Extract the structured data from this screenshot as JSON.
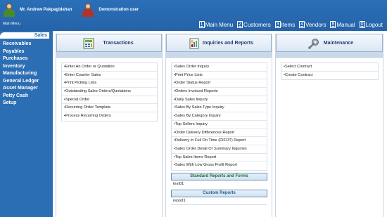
{
  "header": {
    "user_name": "Mr. Andrew Pakpagidahan",
    "company_name": "Demonstration user",
    "main_menu_label": "Main Menu"
  },
  "nav": [
    {
      "num": "1",
      "label": "Main Menu"
    },
    {
      "num": "2",
      "label": "Customers"
    },
    {
      "num": "3",
      "label": "Items"
    },
    {
      "num": "4",
      "label": "Vendors"
    },
    {
      "num": "8",
      "label": "Manual"
    },
    {
      "num": "0",
      "label": "Logout"
    }
  ],
  "sidebar": {
    "items": [
      {
        "label": "Sales"
      },
      {
        "label": "Receivables"
      },
      {
        "label": "Payables"
      },
      {
        "label": "Purchases"
      },
      {
        "label": "Inventory"
      },
      {
        "label": "Manufacturing"
      },
      {
        "label": "General Ledger"
      },
      {
        "label": "Asset Manager"
      },
      {
        "label": "Petty Cash"
      },
      {
        "label": "Setup"
      }
    ]
  },
  "columns": {
    "transactions": {
      "title": "Transactions",
      "icon": "transactions-icon",
      "items": [
        "Enter An Order or Quotation",
        "Enter Counter Sales",
        "Print Picking Lists",
        "Outstanding Sales Orders/Quotations",
        "Special Order",
        "Recurring Order Template",
        "Process Recurring Orders"
      ]
    },
    "inquiries": {
      "title": "Inquiries and Reports",
      "icon": "reports-icon",
      "items": [
        "Sales Order Inquiry",
        "Print Price Lists",
        "Order Status Report",
        "Orders Invoiced Reports",
        "Daily Sales Inquiry",
        "Sales By Sales Type Inquiry",
        "Sales By Category Inquiry",
        "Top Sellers Inquiry",
        "Order Delivery Differences Report",
        "Delivery In Full On Time (DIFOT) Report",
        "Sales Order Detail Or Summary Inquiries",
        "Top Sales Items Report",
        "Sales With Low Gross Profit Report"
      ],
      "standard_reports": {
        "title": "Standard Reports and Forms",
        "link": "test01"
      },
      "custom_reports": {
        "title": "Custom Reports",
        "link": "report1"
      }
    },
    "maintenance": {
      "title": "Maintenance",
      "icon": "wrench-gear-icon",
      "items": [
        "Select Contract",
        "Create Contract"
      ]
    }
  },
  "colors": {
    "background": "#2c6eb4",
    "panel": "#ffffff",
    "header_text": "#1e3f6e"
  }
}
